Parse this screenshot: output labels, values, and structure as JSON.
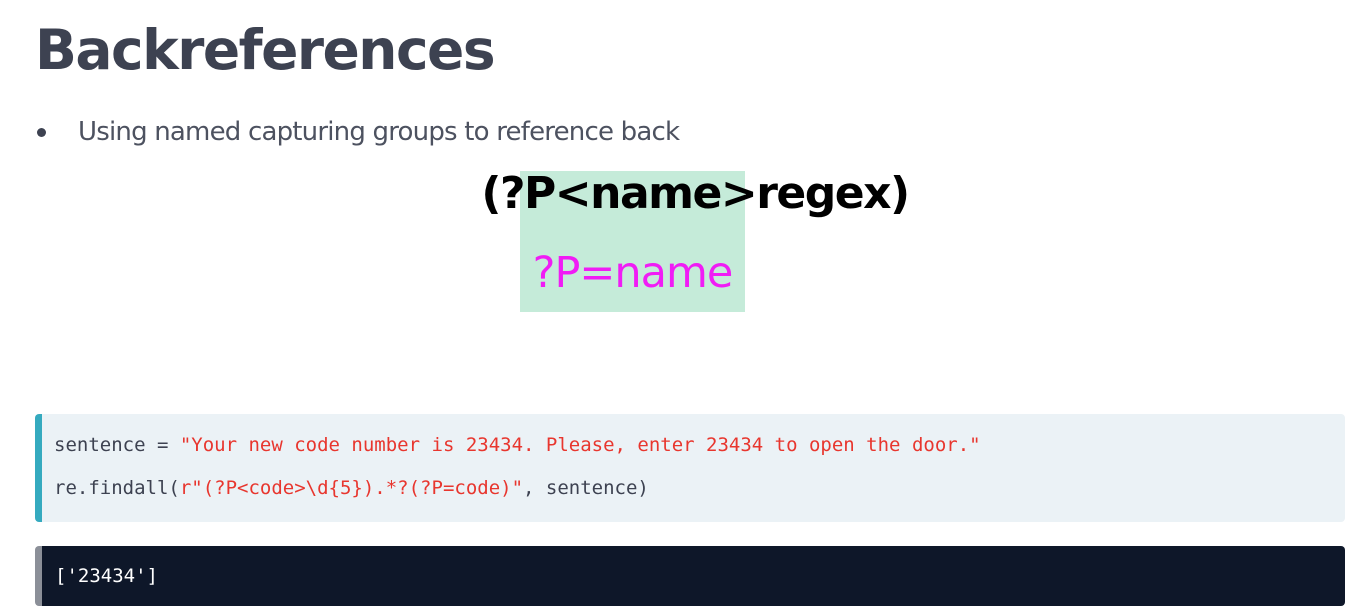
{
  "slide": {
    "title": "Backreferences",
    "bullets": [
      "Using named capturing groups to reference back"
    ]
  },
  "figure": {
    "syntax": "(?P<name>regex)",
    "backref": "?P=name",
    "highlight_color": "#c5ebd9",
    "backref_color": "#f01cf5"
  },
  "code": {
    "line1": {
      "prefix": "sentence = ",
      "string": "\"Your new code number is 23434. Please, enter 23434 to open the door.\""
    },
    "line2": {
      "prefix": "re.findall(",
      "string": "r\"(?P<code>\\d{5}).*?(?P=code)\"",
      "suffix": ", sentence)"
    },
    "accent_color": "#35aabf",
    "string_color": "#e8362e"
  },
  "output": {
    "text": "['23434']"
  }
}
